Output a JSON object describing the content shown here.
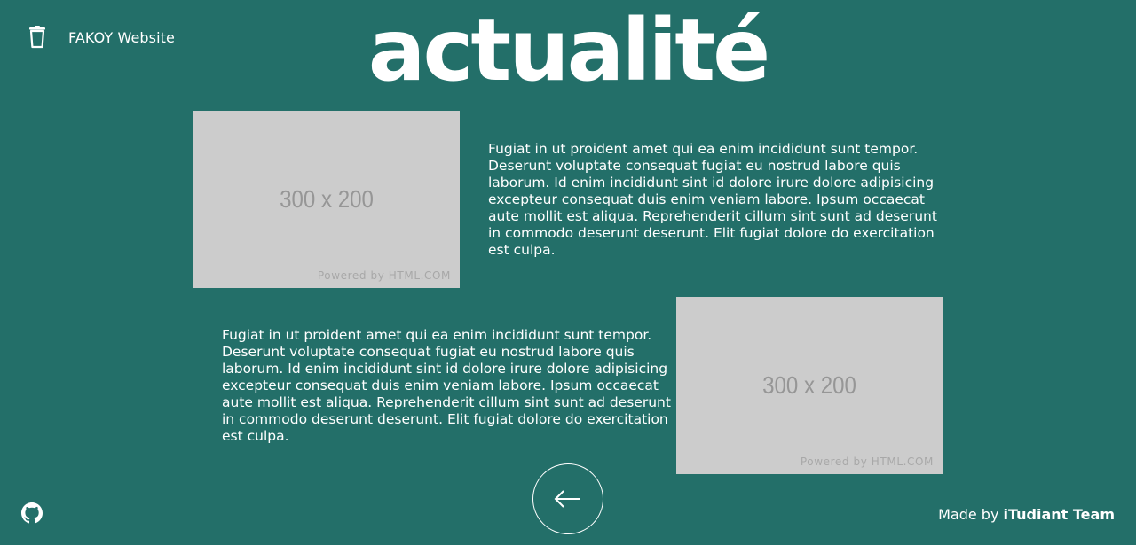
{
  "header": {
    "brand_label": "FAKOY Website",
    "brand_icon": "trash-icon",
    "title": "actualité"
  },
  "articles": [
    {
      "image_text": "300 x 200",
      "image_credit": "Powered by HTML.COM",
      "text": "Fugiat in ut proident amet qui ea enim incididunt sunt tempor. Deserunt voluptate consequat fugiat eu nostrud labore quis laborum. Id enim incididunt sint id dolore irure dolore adipisicing excepteur consequat duis enim veniam labore. Ipsum occaecat aute mollit est aliqua. Reprehenderit cillum sint sunt ad deserunt in commodo deserunt deserunt. Elit fugiat dolore do exercitation est culpa."
    },
    {
      "image_text": "300 x 200",
      "image_credit": "Powered by HTML.COM",
      "text": "Fugiat in ut proident amet qui ea enim incididunt sunt tempor. Deserunt voluptate consequat fugiat eu nostrud labore quis laborum. Id enim incididunt sint id dolore irure dolore adipisicing excepteur consequat duis enim veniam labore. Ipsum occaecat aute mollit est aliqua. Reprehenderit cillum sint sunt ad deserunt in commodo deserunt deserunt. Elit fugiat dolore do exercitation est culpa."
    }
  ],
  "footer": {
    "back_icon": "arrow-left-icon",
    "github_icon": "github-icon",
    "made_by": "Made by",
    "team": "iTudiant Team"
  },
  "colors": {
    "background": "#236f69",
    "text": "#ffffff",
    "placeholder": "#cccccc"
  }
}
